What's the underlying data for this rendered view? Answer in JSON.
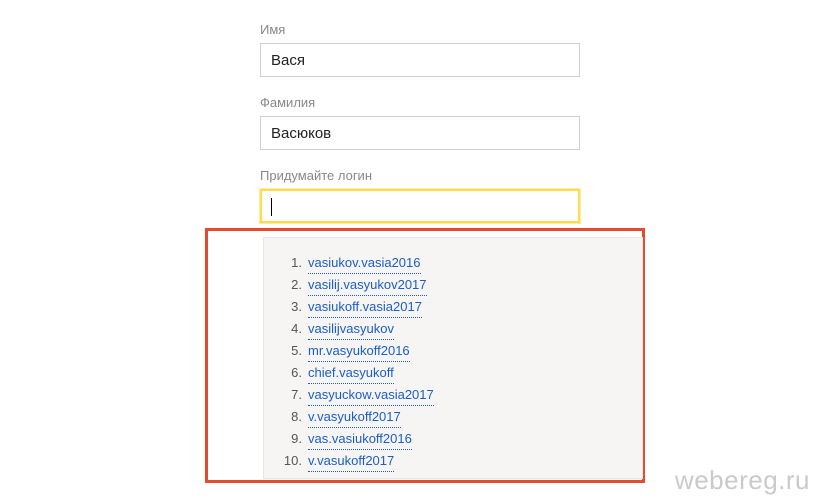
{
  "fields": {
    "first_name": {
      "label": "Имя",
      "value": "Вася"
    },
    "last_name": {
      "label": "Фамилия",
      "value": "Васюков"
    },
    "login": {
      "label": "Придумайте логин",
      "value": ""
    }
  },
  "suggestions": [
    "vasiukov.vasia2016",
    "vasilij.vasyukov2017",
    "vasiukoff.vasia2017",
    "vasilijvasyukov",
    "mr.vasyukoff2016",
    "chief.vasyukoff",
    "vasyuckow.vasia2017",
    "v.vasyukoff2017",
    "vas.vasiukoff2016",
    "v.vasukoff2017"
  ],
  "watermark": "webereg.ru"
}
